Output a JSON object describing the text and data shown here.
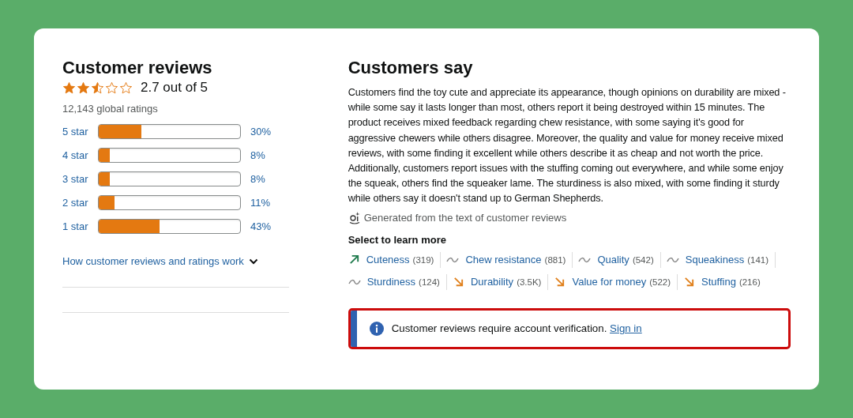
{
  "summary": {
    "title": "Customer reviews",
    "stars": 2.5,
    "rating": "2.7 out of 5",
    "total": "12,143 global ratings"
  },
  "histogram": [
    {
      "label": "5 star",
      "level": 0.3,
      "percent": "30%"
    },
    {
      "label": "4 star",
      "level": 0.08,
      "percent": "8%"
    },
    {
      "label": "3 star",
      "level": 0.08,
      "percent": "8%"
    },
    {
      "label": "2 star",
      "level": 0.11,
      "percent": "11%"
    },
    {
      "label": "1 star",
      "level": 0.43,
      "percent": "43%"
    }
  ],
  "how_link": "How customer reviews and ratings work",
  "customers_say": {
    "title": "Customers say",
    "summary": "Customers find the toy cute and appreciate its appearance, though opinions on durability are mixed - while some say it lasts longer than most, others report it being destroyed within 15 minutes. The product receives mixed feedback regarding chew resistance, with some saying it's good for aggressive chewers while others disagree. Moreover, the quality and value for money receive mixed reviews, with some finding it excellent while others describe it as cheap and not worth the price. Additionally, customers report issues with the stuffing coming out everywhere, and while some enjoy the squeak, others find the squeaker lame. The sturdiness is also mixed, with some finding it sturdy while others say it doesn't stand up to German Shepherds.",
    "ai_note": "Generated from the text of customer reviews",
    "select_label": "Select to learn more"
  },
  "aspects": [
    [
      {
        "kind": "positive",
        "label": "Cuteness",
        "count": "(319)"
      },
      {
        "kind": "mixed",
        "label": "Chew resistance",
        "count": "(881)"
      },
      {
        "kind": "mixed",
        "label": "Quality",
        "count": "(542)"
      },
      {
        "kind": "mixed",
        "label": "Squeakiness",
        "count": "(141)"
      }
    ],
    [
      {
        "kind": "mixed",
        "label": "Sturdiness",
        "count": "(124)"
      },
      {
        "kind": "negative",
        "label": "Durability",
        "count": "(3.5K)"
      },
      {
        "kind": "negative",
        "label": "Value for money",
        "count": "(522)"
      },
      {
        "kind": "negative",
        "label": "Stuffing",
        "count": "(216)"
      }
    ]
  ],
  "alert": {
    "message": "Customer reviews require account verification.",
    "link": "Sign in"
  }
}
